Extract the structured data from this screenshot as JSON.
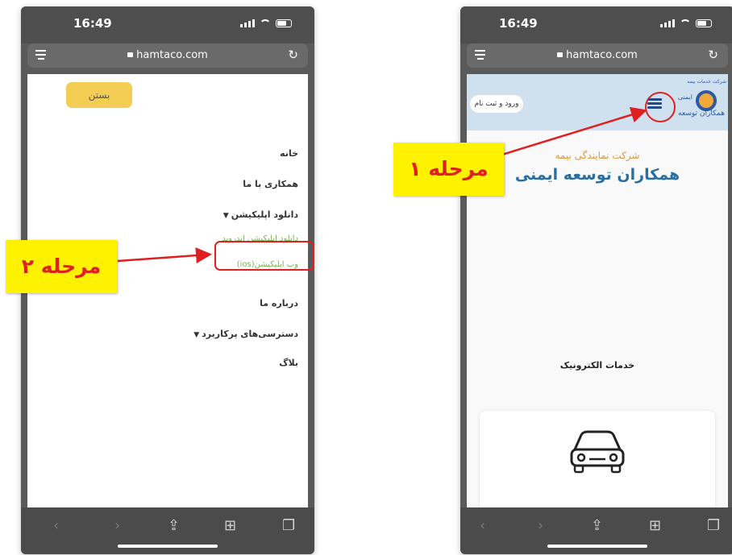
{
  "phones": {
    "left": {
      "status_time": "16:49",
      "url": "hamtaco.com",
      "menu": {
        "close_label": "بستن",
        "items": [
          {
            "label": "خانه",
            "type": "link"
          },
          {
            "label": "همکاری با ما",
            "type": "link"
          },
          {
            "label": "دانلود اپلیکیشن",
            "type": "dropdown"
          },
          {
            "label": "دانلود اپلیکیشن اندروید",
            "type": "sublink"
          },
          {
            "label": "وب اپلیکیشن(ios)",
            "type": "sublink"
          },
          {
            "label": "درباره ما",
            "type": "link"
          },
          {
            "label": "دسترسی‌های پرکاربرد",
            "type": "dropdown"
          },
          {
            "label": "بلاگ",
            "type": "link"
          }
        ]
      }
    },
    "right": {
      "status_time": "16:49",
      "url": "hamtaco.com",
      "header": {
        "login_label": "ورود و ثبت نام",
        "logo_top": "شرکت خدمات بیمه",
        "logo_name": "همکاران توسعه",
        "logo_side": "ایمنی"
      },
      "subtitle": "شرکت نمایندگی بیمه",
      "hero_title": "همکاران توسعه ایمنی",
      "section_title": "خدمات الکترونیک"
    }
  },
  "annotations": {
    "step1": "مرحله ۱",
    "step2": "مرحله ۲",
    "highlight_color": "#e02020",
    "callout_bg": "#fff200"
  },
  "colors": {
    "accent_yellow": "#f4cd55",
    "brand_blue": "#2a6fa3",
    "submenu_green": "#79b356"
  },
  "icons": {
    "car": "car-icon",
    "menu": "hamburger-menu-icon",
    "share": "share-icon",
    "bookmarks": "bookmarks-icon",
    "tabs": "tabs-icon"
  }
}
